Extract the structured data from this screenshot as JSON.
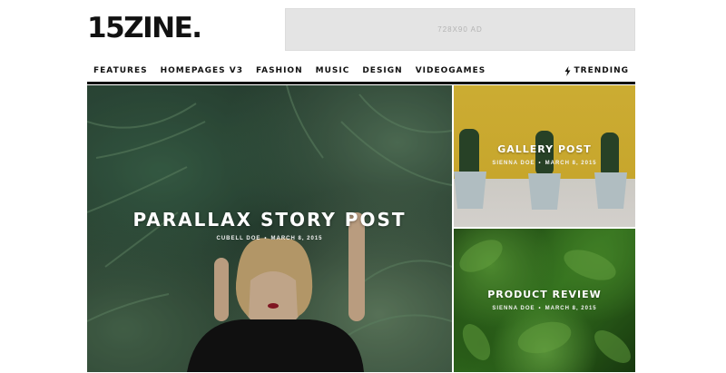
{
  "header": {
    "logo": "15ZINE.",
    "ad_text": "728X90 AD"
  },
  "nav": {
    "items": [
      {
        "label": "FEATURES"
      },
      {
        "label": "HOMEPAGES V3"
      },
      {
        "label": "FASHION"
      },
      {
        "label": "MUSIC"
      },
      {
        "label": "DESIGN"
      },
      {
        "label": "VIDEOGAMES"
      }
    ],
    "trending_label": "TRENDING",
    "trending_icon": "lightning-bolt-icon"
  },
  "posts": {
    "main": {
      "title": "PARALLAX STORY POST",
      "author": "CUBELL DOE",
      "date": "MARCH 8, 2015"
    },
    "gallery": {
      "title": "GALLERY POST",
      "author": "SIENNA DOE",
      "date": "MARCH 8, 2015"
    },
    "review": {
      "title": "PRODUCT REVIEW",
      "author": "SIENNA DOE",
      "date": "MARCH 8, 2015"
    }
  },
  "colors": {
    "text": "#111111",
    "ad_bg": "#e4e4e4",
    "gallery_yellow": "#e3be33",
    "review_green": "#3f8a25"
  }
}
